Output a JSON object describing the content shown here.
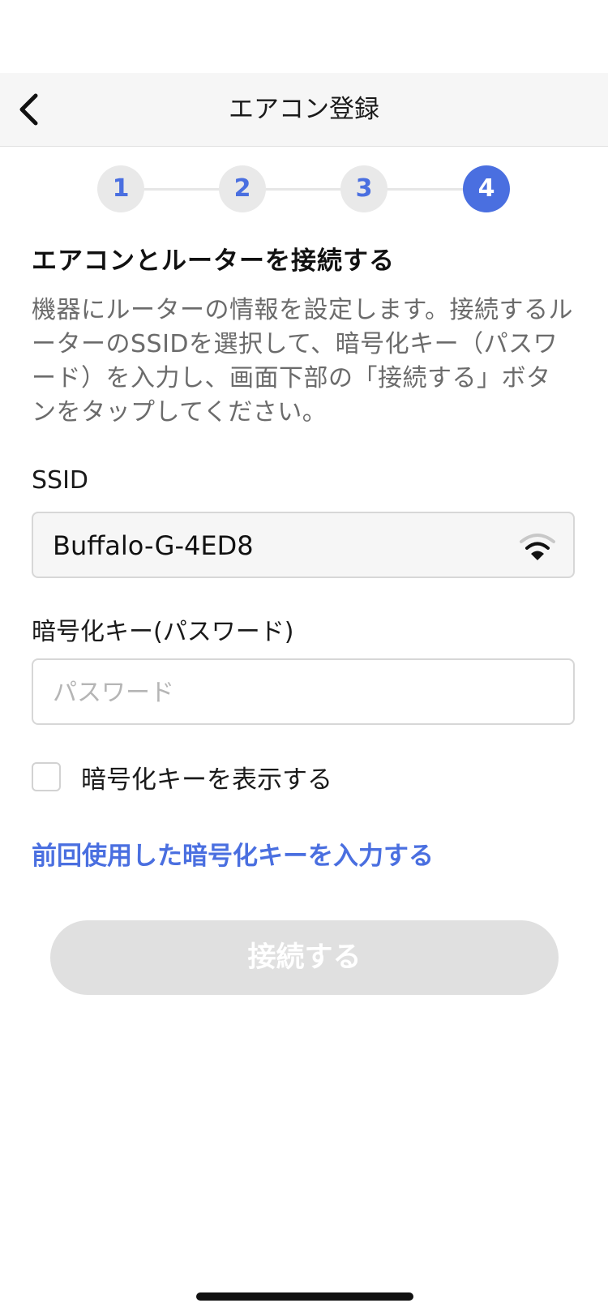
{
  "nav": {
    "title": "エアコン登録"
  },
  "steps": [
    "1",
    "2",
    "3",
    "4"
  ],
  "current_step": 4,
  "heading": "エアコンとルーターを接続する",
  "description": "機器にルーターの情報を設定します。接続するルーターのSSIDを選択して、暗号化キー（パスワード）を入力し、画面下部の「接続する」ボタンをタップしてください。",
  "ssid": {
    "label": "SSID",
    "value": "Buffalo-G-4ED8",
    "icon": "wifi-icon"
  },
  "password": {
    "label": "暗号化キー(パスワード)",
    "placeholder": "パスワード",
    "value": ""
  },
  "show_key": {
    "label": "暗号化キーを表示する",
    "checked": false
  },
  "previous_key_link": "前回使用した暗号化キーを入力する",
  "connect_button": "接続する",
  "colors": {
    "accent": "#4a6fe0",
    "disabled_button": "#e0e0e0"
  }
}
